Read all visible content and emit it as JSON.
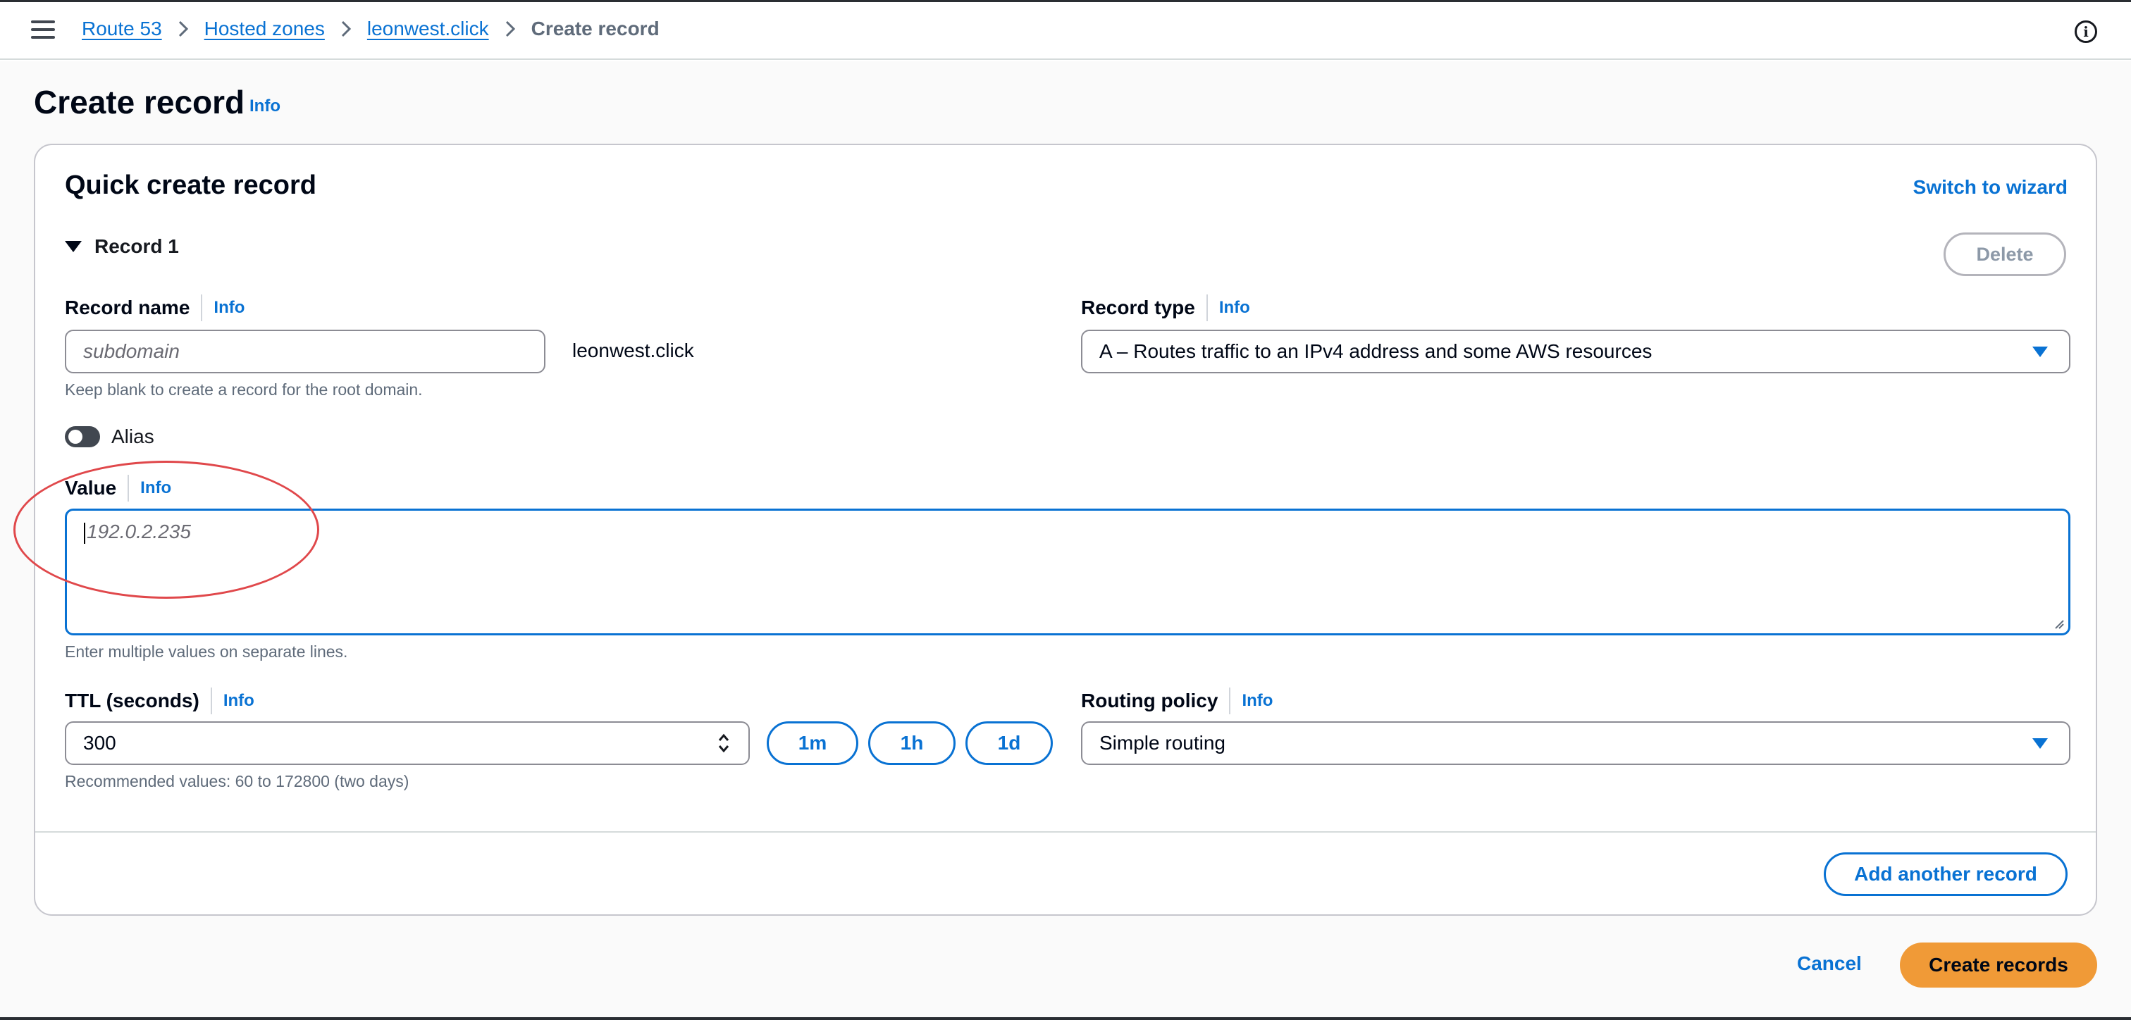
{
  "breadcrumb": {
    "items": [
      "Route 53",
      "Hosted zones",
      "leonwest.click"
    ],
    "current": "Create record"
  },
  "page": {
    "title": "Create record",
    "info": "Info"
  },
  "container": {
    "title": "Quick create record",
    "switch_wizard": "Switch to wizard",
    "record_header": "Record 1",
    "delete_label": "Delete"
  },
  "record_name": {
    "label": "Record name",
    "info": "Info",
    "placeholder": "subdomain",
    "suffix": "leonwest.click",
    "help": "Keep blank to create a record for the root domain."
  },
  "record_type": {
    "label": "Record type",
    "info": "Info",
    "value": "A – Routes traffic to an IPv4 address and some AWS resources"
  },
  "alias": {
    "label": "Alias",
    "enabled": false
  },
  "value_field": {
    "label": "Value",
    "info": "Info",
    "placeholder": "192.0.2.235",
    "help": "Enter multiple values on separate lines."
  },
  "ttl": {
    "label": "TTL (seconds)",
    "info": "Info",
    "value": "300",
    "help": "Recommended values: 60 to 172800 (two days)",
    "presets": [
      "1m",
      "1h",
      "1d"
    ]
  },
  "routing_policy": {
    "label": "Routing policy",
    "info": "Info",
    "value": "Simple routing"
  },
  "actions": {
    "add_another": "Add another record",
    "cancel": "Cancel",
    "create": "Create records"
  },
  "colors": {
    "link": "#0972d3",
    "primary_button": "#f09a37",
    "annotation": "#e0484b"
  }
}
